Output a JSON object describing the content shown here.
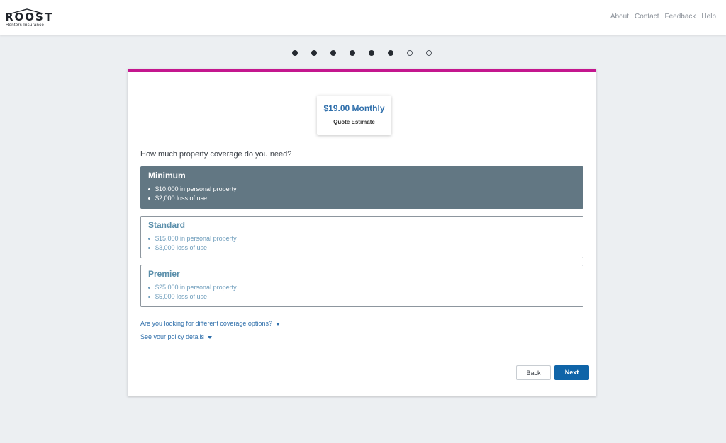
{
  "header": {
    "logo_text": "ROOST",
    "logo_subtitle": "Renters Insurance",
    "nav": [
      "About",
      "Contact",
      "Feedback",
      "Help"
    ]
  },
  "progress": {
    "completed_steps": 6,
    "total_steps": 8
  },
  "quote": {
    "price": "$19.00 Monthly",
    "label": "Quote Estimate"
  },
  "question": "How much property coverage do you need?",
  "options": [
    {
      "title": "Minimum",
      "items": [
        "$10,000 in personal property",
        "$2,000 loss of use"
      ],
      "selected": true
    },
    {
      "title": "Standard",
      "items": [
        "$15,000 in personal property",
        "$3,000 loss of use"
      ],
      "selected": false
    },
    {
      "title": "Premier",
      "items": [
        "$25,000 in personal property",
        "$5,000 loss of use"
      ],
      "selected": false
    }
  ],
  "links": {
    "different_coverage": "Are you looking for different coverage options?",
    "policy_details": "See your policy details"
  },
  "buttons": {
    "back": "Back",
    "next": "Next"
  },
  "colors": {
    "accent_bar": "#c4168e",
    "selected_option": "#627783",
    "primary_button": "#0f64a8",
    "link": "#2f6fab"
  }
}
